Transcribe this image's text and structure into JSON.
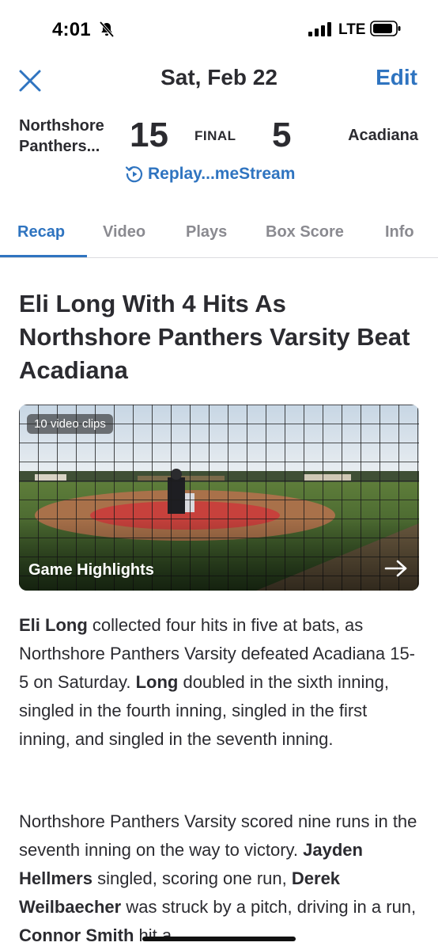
{
  "status_bar": {
    "time": "4:01",
    "network": "LTE"
  },
  "nav": {
    "title": "Sat, Feb 22",
    "edit_label": "Edit"
  },
  "scoreboard": {
    "home_team_line1": "Northshore",
    "home_team_line2": "Panthers...",
    "home_score": "15",
    "status": "FINAL",
    "away_score": "5",
    "away_team": "Acadiana",
    "replay_label": "Replay...meStream"
  },
  "tabs": [
    {
      "label": "Recap"
    },
    {
      "label": "Video"
    },
    {
      "label": "Plays"
    },
    {
      "label": "Box Score"
    },
    {
      "label": "Info"
    }
  ],
  "article": {
    "headline": "Eli Long With 4 Hits As Northshore Panthers Varsity Beat Acadiana",
    "video": {
      "badge": "10 video clips",
      "title": "Game Highlights"
    },
    "p1": {
      "s1": "Eli Long",
      "s2": " collected four hits in five at bats, as Northshore Panthers Varsity defeated Acadiana 15-5 on Saturday. ",
      "s3": "Long",
      "s4": " doubled in the sixth inning, singled in the fourth inning, singled in the first inning, and singled in the seventh inning."
    },
    "p2": {
      "s1": "Northshore Panthers Varsity scored nine runs in the seventh inning on the way to victory.  ",
      "s2": "Jayden Hellmers",
      "s3": " singled, scoring one run, ",
      "s4": "Derek Weilbaecher",
      "s5": " was struck by a pitch, driving in a run, ",
      "s6": "Connor Smith",
      "s7": " hit a"
    }
  },
  "colors": {
    "accent": "#2f74c0",
    "text": "#2b2b30",
    "muted": "#8a8a90"
  }
}
